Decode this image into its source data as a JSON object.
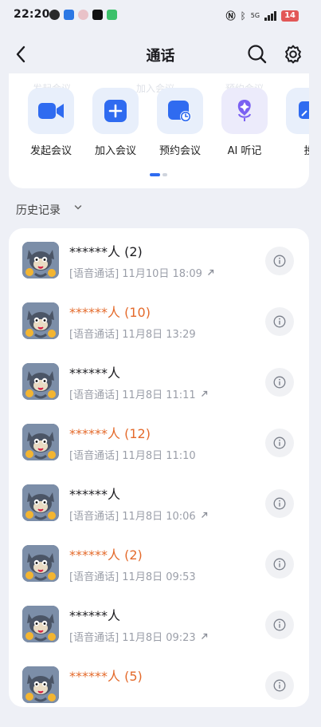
{
  "status_bar": {
    "time": "22:20",
    "network": "5G",
    "battery": "14",
    "colors": {
      "battery": "#e25757"
    }
  },
  "header": {
    "title": "通话",
    "icons": [
      "back-arrow-icon",
      "search-icon",
      "gear-icon"
    ]
  },
  "quick_actions": {
    "ghost_labels": [
      "发起会议",
      "加入会议",
      "预约会议"
    ],
    "items": [
      {
        "label": "发起会议",
        "icon": "video-camera-icon"
      },
      {
        "label": "加入会议",
        "icon": "plus-icon"
      },
      {
        "label": "预约会议",
        "icon": "calendar-clock-icon"
      },
      {
        "label": "AI 听记",
        "icon": "ai-mic-icon"
      },
      {
        "label": "投",
        "icon": "screen-cast-icon"
      }
    ],
    "page_indicator": {
      "current": 1,
      "total": 2
    },
    "colors": {
      "accent": "#2f6bf0",
      "tile_bg": "#e8effb",
      "ai_purple": "#7b61f2"
    }
  },
  "history": {
    "label": "历史记录",
    "colors": {
      "missed": "#e46a2b",
      "normal": "#1b1b1f",
      "sub": "#9a9ea8"
    },
    "items": [
      {
        "title": "******人 (2)",
        "subtitle": "[语音通话] 11月10日 18:09",
        "missed": false,
        "outgoing": true
      },
      {
        "title": "******人 (10)",
        "subtitle": "[语音通话] 11月8日 13:29",
        "missed": true,
        "outgoing": false
      },
      {
        "title": "******人",
        "subtitle": "[语音通话] 11月8日 11:11",
        "missed": false,
        "outgoing": true
      },
      {
        "title": "******人 (12)",
        "subtitle": "[语音通话] 11月8日 11:10",
        "missed": true,
        "outgoing": false
      },
      {
        "title": "******人",
        "subtitle": "[语音通话] 11月8日 10:06",
        "missed": false,
        "outgoing": true
      },
      {
        "title": "******人 (2)",
        "subtitle": "[语音通话] 11月8日 09:53",
        "missed": true,
        "outgoing": false
      },
      {
        "title": "******人",
        "subtitle": "[语音通话] 11月8日 09:23",
        "missed": false,
        "outgoing": true
      },
      {
        "title": "******人 (5)",
        "subtitle": "",
        "missed": true,
        "outgoing": false
      }
    ]
  }
}
